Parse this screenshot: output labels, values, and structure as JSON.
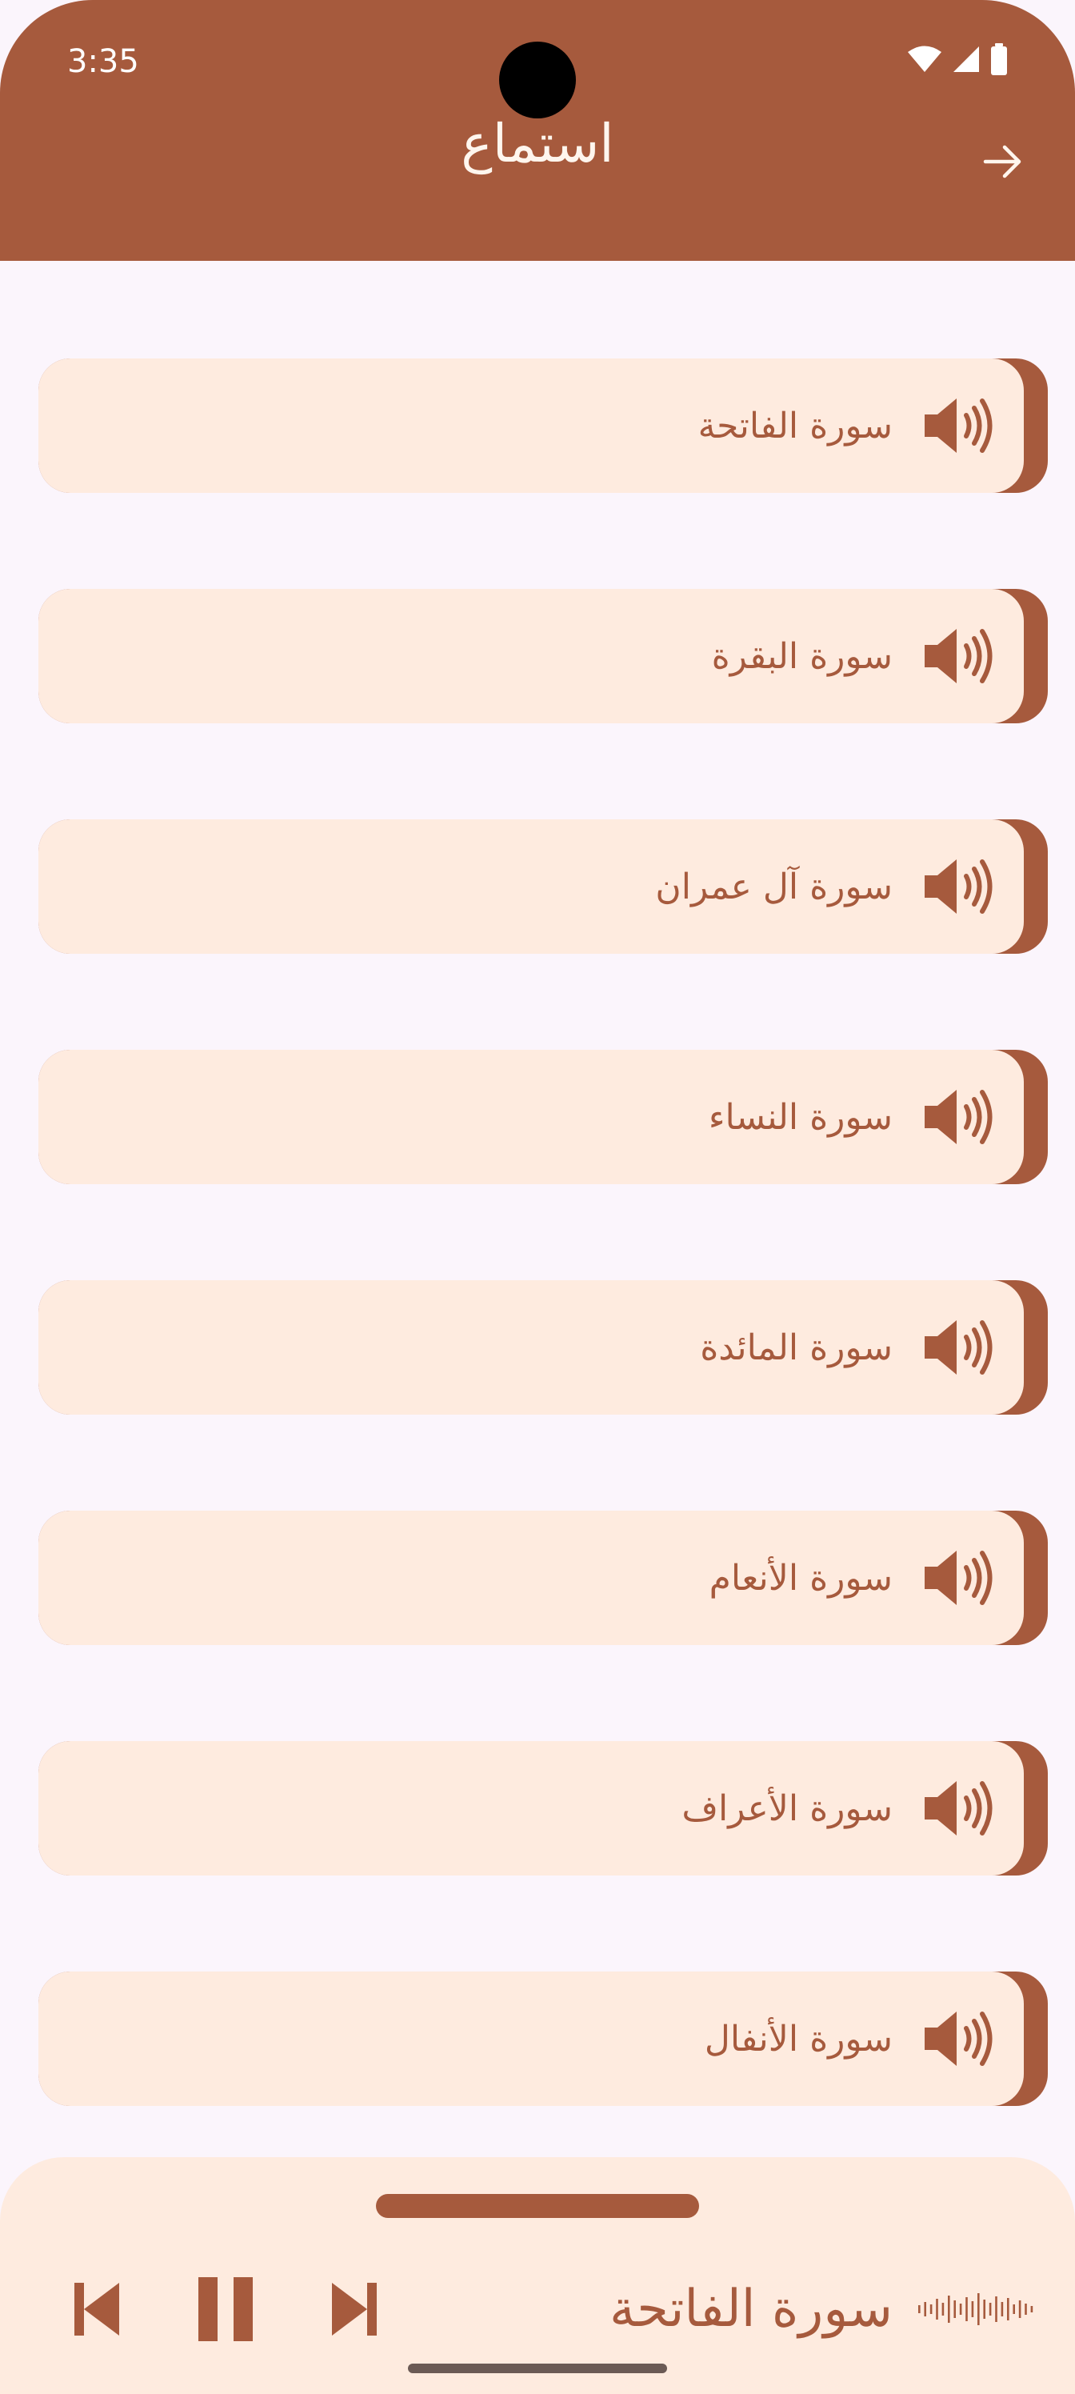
{
  "status_bar": {
    "time": "3:35",
    "icons": [
      "wifi-icon",
      "signal-icon",
      "battery-icon"
    ]
  },
  "header": {
    "title": "استماع",
    "nav_icon": "arrow-forward-icon"
  },
  "surah_list": {
    "item_icon": "speaker-icon",
    "items": [
      {
        "label": "سورة الفاتحة"
      },
      {
        "label": "سورة البقرة"
      },
      {
        "label": "سورة آل عمران"
      },
      {
        "label": "سورة النساء"
      },
      {
        "label": "سورة المائدة"
      },
      {
        "label": "سورة الأنعام"
      },
      {
        "label": "سورة الأعراف"
      },
      {
        "label": "سورة الأنفال"
      }
    ]
  },
  "player": {
    "now_playing": "سورة الفاتحة",
    "state": "playing",
    "controls": [
      "previous-icon",
      "pause-icon",
      "next-icon"
    ]
  },
  "colors": {
    "primary": "#A65A3D",
    "card_background": "#FEEBDF",
    "page_background": "#FBF5FC",
    "on_primary": "#FFF6EE"
  }
}
